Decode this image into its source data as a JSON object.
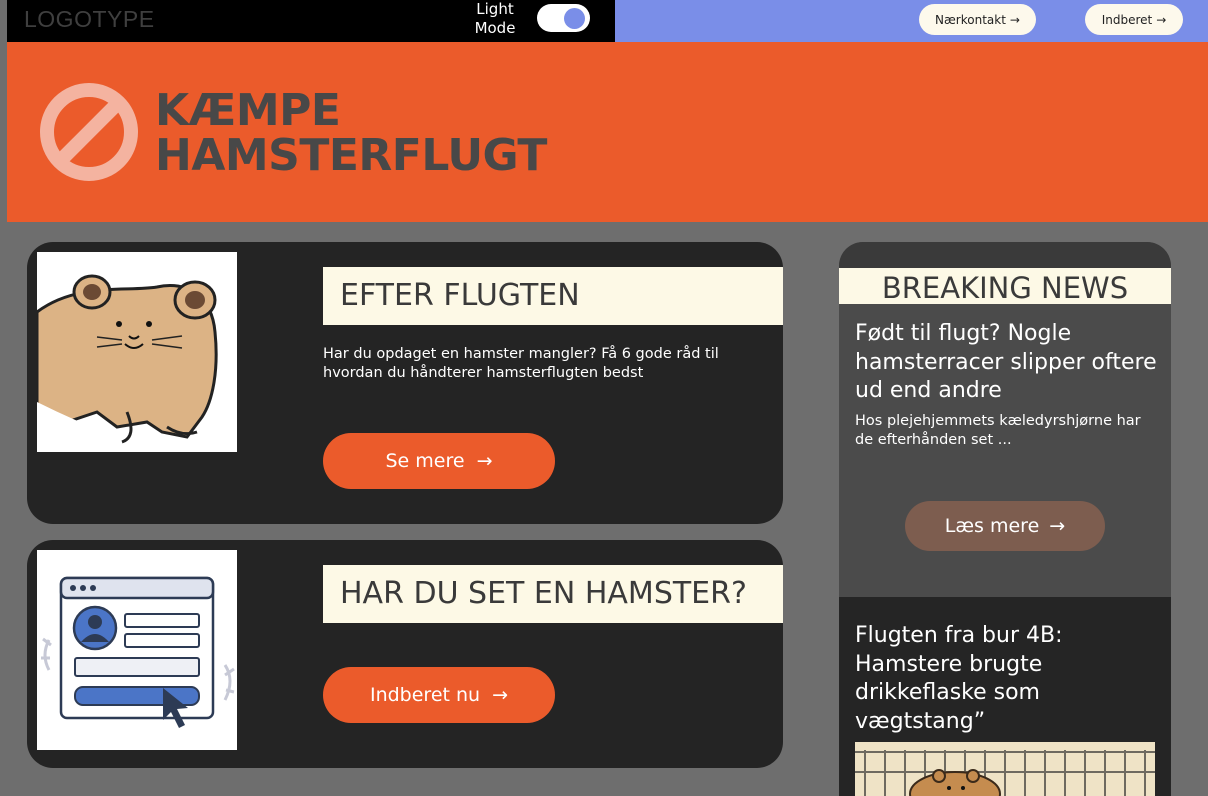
{
  "header": {
    "logo": "LOGOTYPE",
    "mode_label": "Light Mode",
    "nav": [
      {
        "label": "Nærkontakt",
        "arrow": "→"
      },
      {
        "label": "Indberet",
        "arrow": "→"
      }
    ]
  },
  "hero": {
    "title_line1": "KÆMPE",
    "title_line2": "HAMSTERFLUGT",
    "icon": "prohibition-icon"
  },
  "cards": [
    {
      "heading": "EFTER FLUGTEN",
      "description": "Har du opdaget en hamster mangler? Få 6 gode råd til hvordan du håndterer hamsterflugten bedst",
      "button": "Se mere",
      "arrow": "→",
      "image": "hamster-illustration"
    },
    {
      "heading": "HAR DU SET EN HAMSTER?",
      "button": "Indberet nu",
      "arrow": "→",
      "image": "report-form-illustration"
    }
  ],
  "breaking_news": {
    "title": "BREAKING NEWS",
    "items": [
      {
        "headline": "Født til flugt? Nogle hamsterracer slipper oftere ud end andre",
        "teaser": "Hos plejehjemmets kæledyrshjørne har de efterhånden set ...",
        "button": "Læs mere",
        "arrow": "→"
      },
      {
        "headline": "Flugten fra bur 4B: Hamstere brugte drikkeflaske som vægtstang”",
        "image": "hamster-cage-illustration"
      }
    ]
  },
  "colors": {
    "accent_orange": "#eb5b2b",
    "accent_blue": "#7a8ee8",
    "cream": "#fdf9e6",
    "card_dark": "#242424",
    "button_brown": "#7d5d4f"
  }
}
